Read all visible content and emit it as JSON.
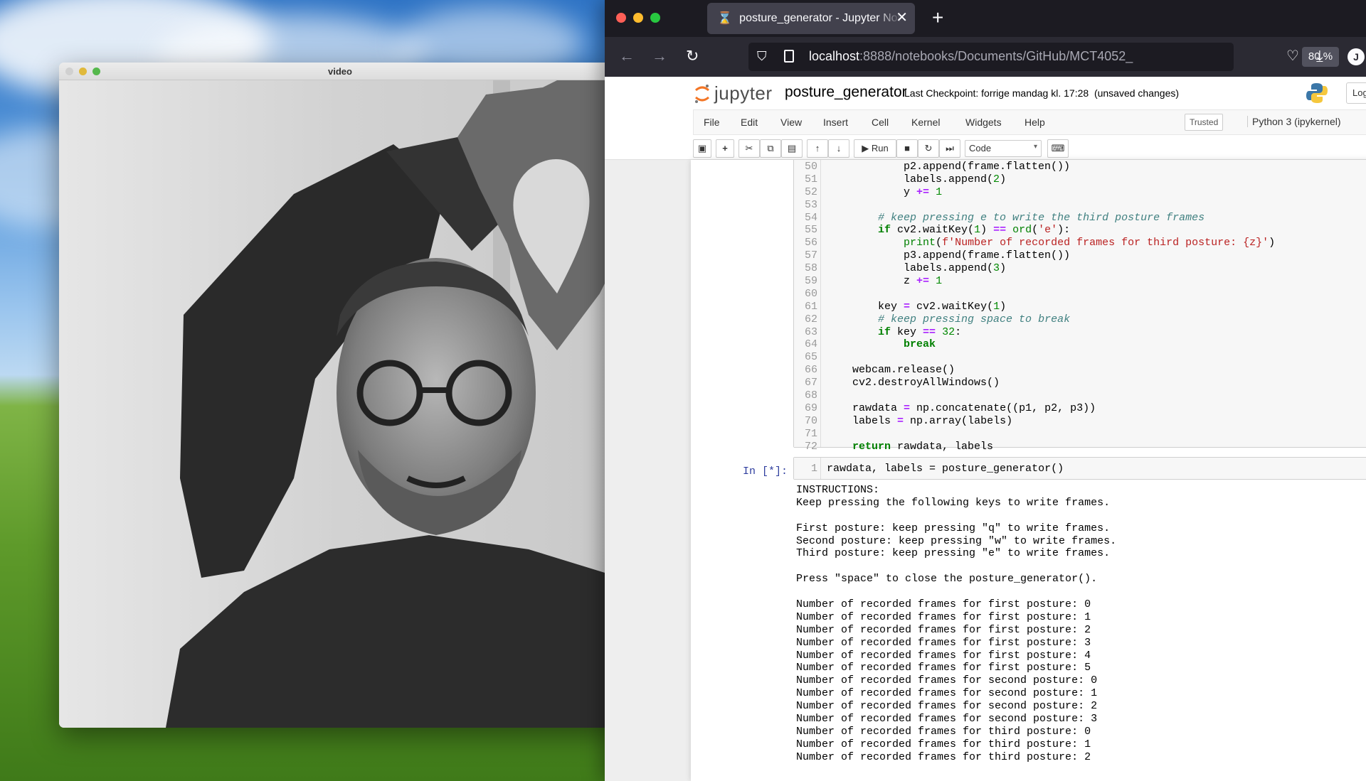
{
  "video_window": {
    "title": "video"
  },
  "browser": {
    "tab_title": "posture_generator - Jupyter Notebook",
    "url_host": "localhost",
    "url_path": ":8888/notebooks/Documents/GitHub/MCT4052_",
    "zoom": "80 %",
    "profile_initial": "J"
  },
  "jupyter": {
    "logo_text": "jupyter",
    "notebook_name": "posture_generator",
    "checkpoint": "Last Checkpoint: forrige mandag kl. 17:28",
    "unsaved": "(unsaved changes)",
    "logout": "Logout",
    "menu": [
      "File",
      "Edit",
      "View",
      "Insert",
      "Cell",
      "Kernel",
      "Widgets",
      "Help"
    ],
    "trusted": "Trusted",
    "kernel": "Python 3 (ipykernel)",
    "toolbar": {
      "run_label": "Run",
      "cell_type": "Code"
    }
  },
  "cell1": {
    "lines": [
      {
        "n": "50",
        "text": "            p2.append(frame.flatten())"
      },
      {
        "n": "51",
        "text": "            labels.append(2)"
      },
      {
        "n": "52",
        "text": "            y += 1"
      },
      {
        "n": "53",
        "text": ""
      },
      {
        "n": "54",
        "text": "        # keep pressing e to write the third posture frames"
      },
      {
        "n": "55",
        "text": "        if cv2.waitKey(1) == ord('e'):"
      },
      {
        "n": "56",
        "text": "            print(f'Number of recorded frames for third posture: {z}')"
      },
      {
        "n": "57",
        "text": "            p3.append(frame.flatten())"
      },
      {
        "n": "58",
        "text": "            labels.append(3)"
      },
      {
        "n": "59",
        "text": "            z += 1"
      },
      {
        "n": "60",
        "text": ""
      },
      {
        "n": "61",
        "text": "        key = cv2.waitKey(1)"
      },
      {
        "n": "62",
        "text": "        # keep pressing space to break"
      },
      {
        "n": "63",
        "text": "        if key == 32:"
      },
      {
        "n": "64",
        "text": "            break"
      },
      {
        "n": "65",
        "text": ""
      },
      {
        "n": "66",
        "text": "    webcam.release()"
      },
      {
        "n": "67",
        "text": "    cv2.destroyAllWindows()"
      },
      {
        "n": "68",
        "text": ""
      },
      {
        "n": "69",
        "text": "    rawdata = np.concatenate((p1, p2, p3))"
      },
      {
        "n": "70",
        "text": "    labels = np.array(labels)"
      },
      {
        "n": "71",
        "text": ""
      },
      {
        "n": "72",
        "text": "    return rawdata, labels"
      }
    ]
  },
  "cell2": {
    "prompt": "In [*]:",
    "line_number": "1",
    "code": "rawdata, labels = posture_generator()",
    "output": [
      "INSTRUCTIONS:",
      "Keep pressing the following keys to write frames.",
      "",
      "First posture: keep pressing \"q\" to write frames.",
      "Second posture: keep pressing \"w\" to write frames.",
      "Third posture: keep pressing \"e\" to write frames.",
      "",
      "Press \"space\" to close the posture_generator().",
      "",
      "Number of recorded frames for first posture: 0",
      "Number of recorded frames for first posture: 1",
      "Number of recorded frames for first posture: 2",
      "Number of recorded frames for first posture: 3",
      "Number of recorded frames for first posture: 4",
      "Number of recorded frames for first posture: 5",
      "Number of recorded frames for second posture: 0",
      "Number of recorded frames for second posture: 1",
      "Number of recorded frames for second posture: 2",
      "Number of recorded frames for second posture: 3",
      "Number of recorded frames for third posture: 0",
      "Number of recorded frames for third posture: 1",
      "Number of recorded frames for third posture: 2"
    ]
  },
  "colors": {
    "traffic_red": "#ff5f57",
    "traffic_yellow": "#febc2e",
    "traffic_green": "#28c840",
    "prompt_blue": "#303f9f",
    "firefox_dark": "#1c1b22"
  }
}
